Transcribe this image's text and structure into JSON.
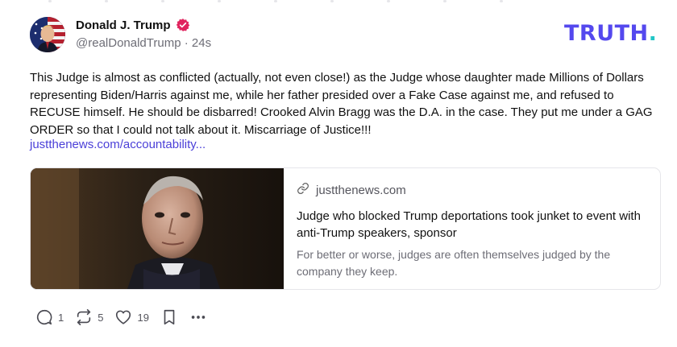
{
  "post": {
    "author_name": "Donald J. Trump",
    "handle": "@realDonaldTrump",
    "separator": "·",
    "time": "24s",
    "text": "This Judge is almost as conflicted (actually, not even close!) as the Judge whose daughter made Millions of Dollars representing Biden/Harris against me, while her father presided over a Fake Case against me, and refused to RECUSE himself. He should be disbarred! Crooked Alvin Bragg was the D.A. in the case. They put me under a GAG ORDER so that I could not talk about it. Miscarriage of Justice!!!",
    "link": "justthenews.com/accountability..."
  },
  "brand": {
    "main": "TRUTH",
    "dot": "."
  },
  "card": {
    "domain": "justthenews.com",
    "title": "Judge who blocked Trump deportations took junket to event with anti-Trump speakers, sponsor",
    "description": "For better or worse, judges are often themselves judged by the company they keep."
  },
  "actions": {
    "replies": "1",
    "retruths": "5",
    "likes": "19"
  },
  "colors": {
    "brand": "#5448ee",
    "brand_dot": "#22c7c7",
    "link": "#4a3fd8",
    "verified": "#e0245e"
  },
  "icons": [
    "reply-icon",
    "retruth-icon",
    "like-icon",
    "bookmark-icon",
    "more-icon",
    "link-icon",
    "verified-badge-icon"
  ]
}
